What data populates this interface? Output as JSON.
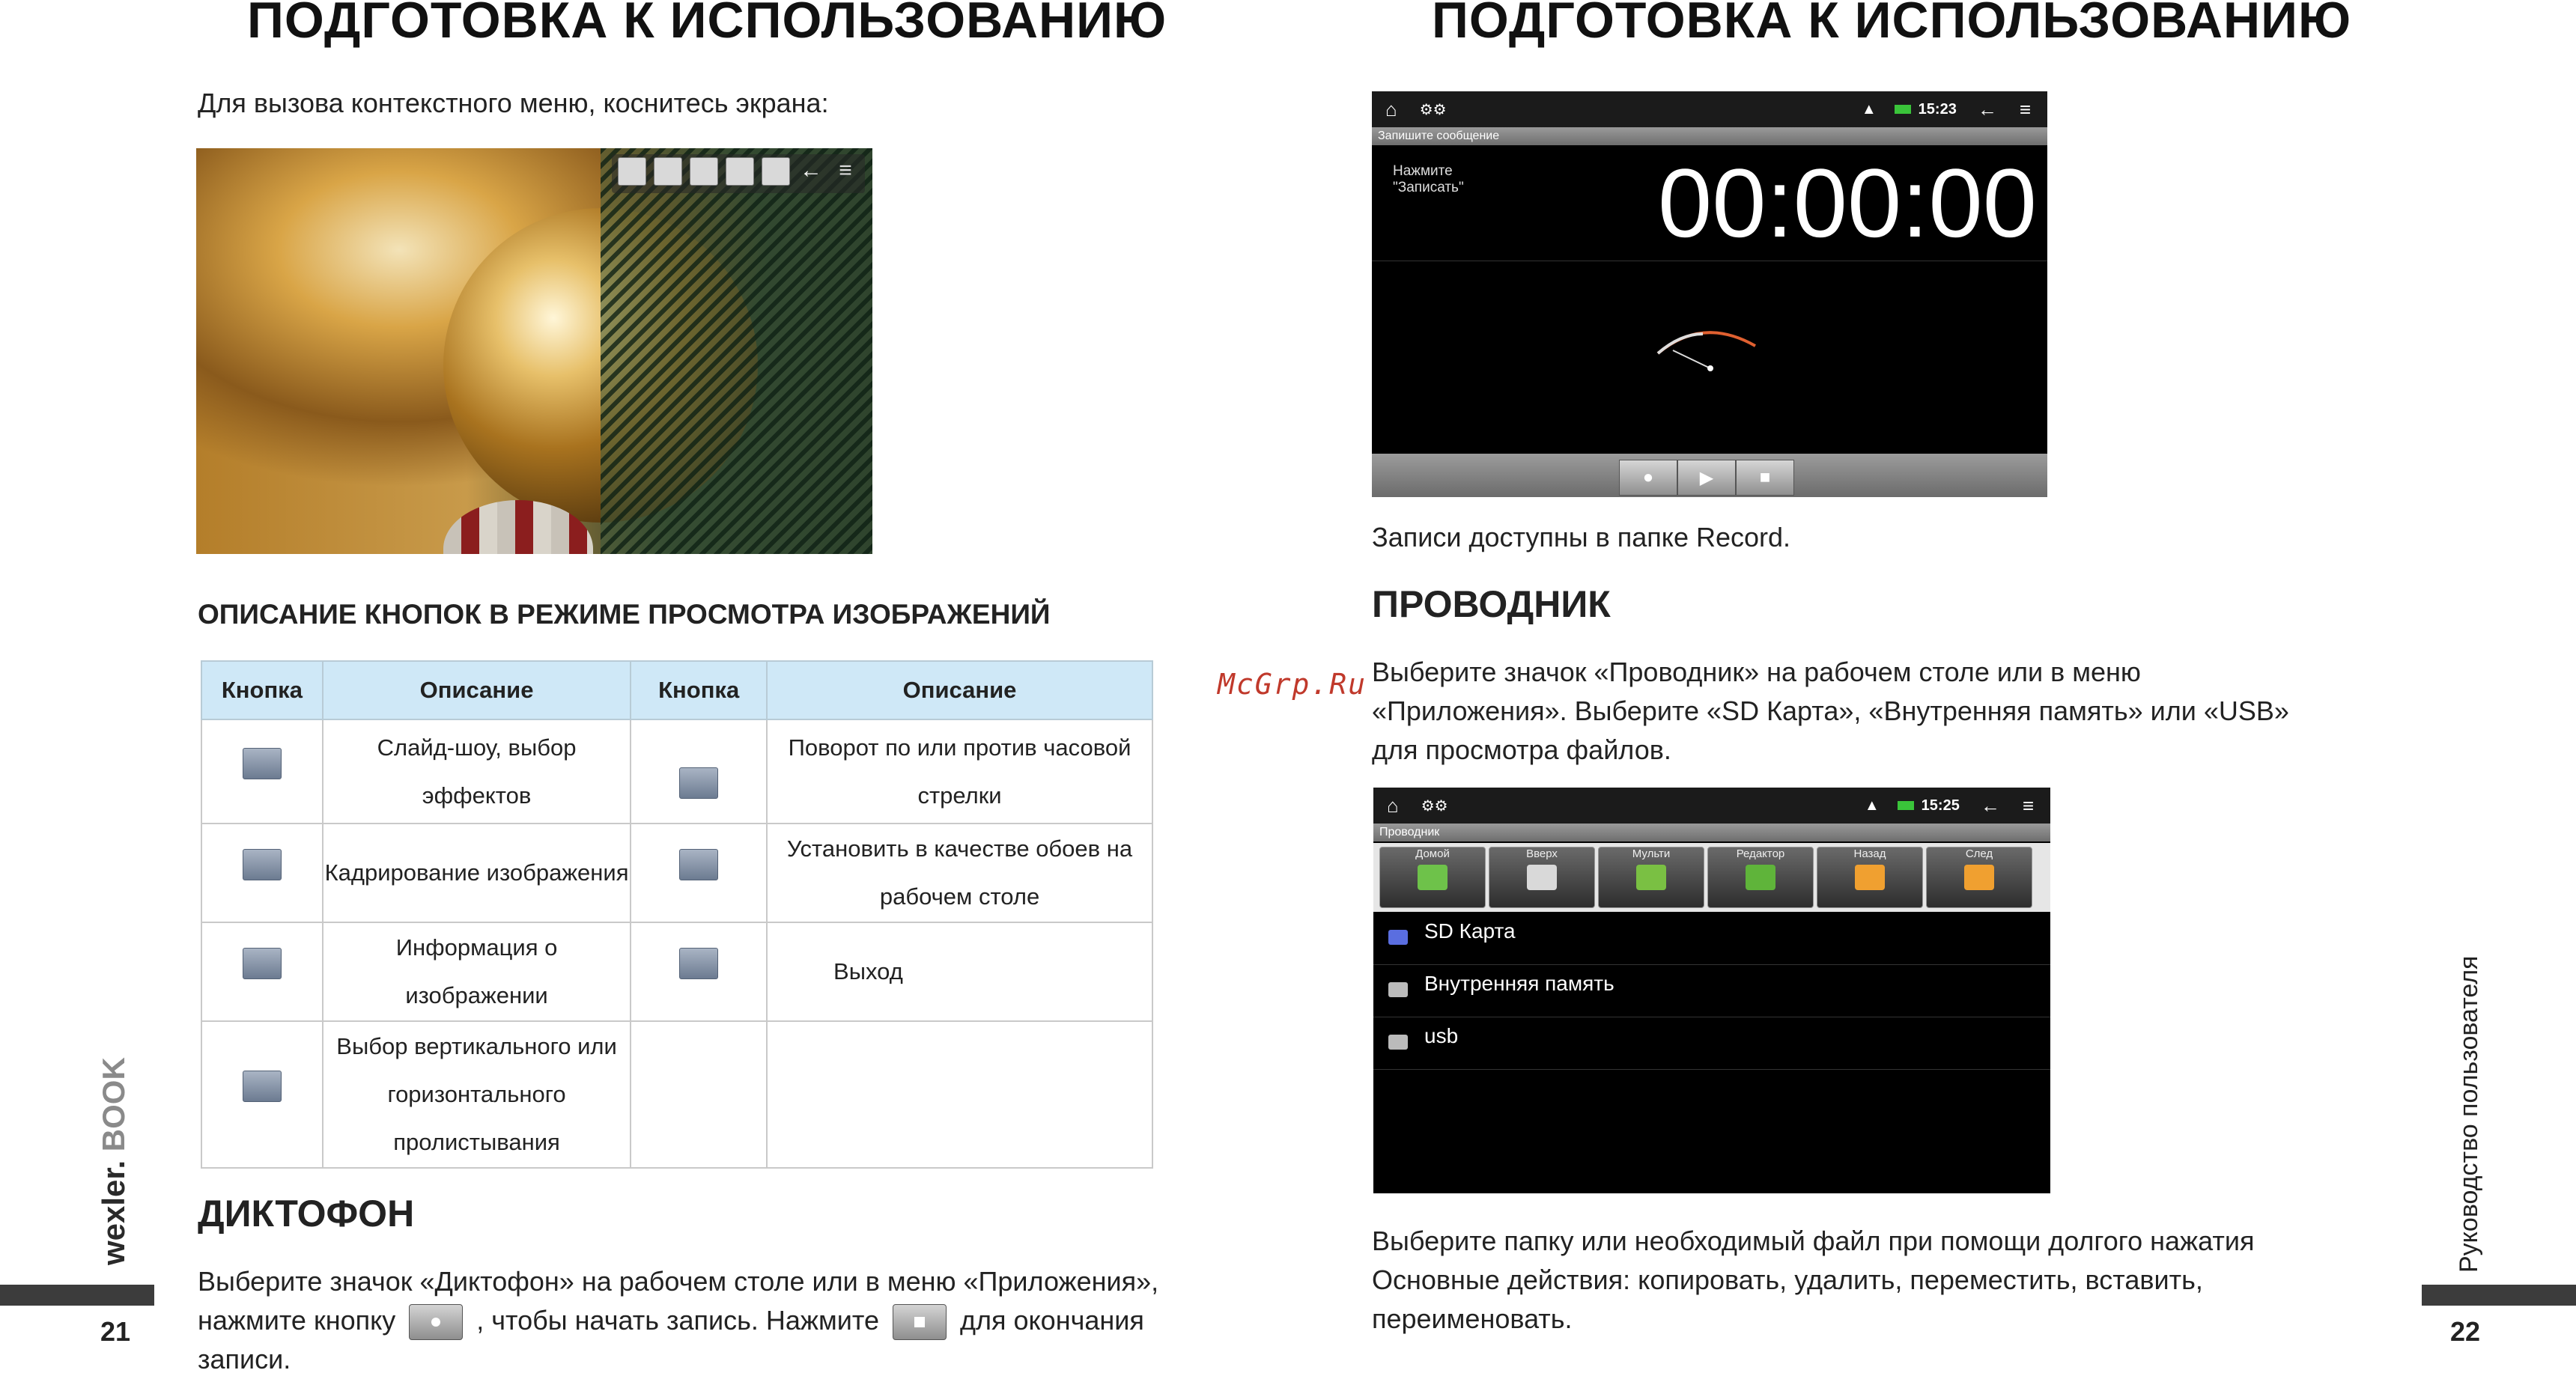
{
  "left_page": {
    "title": "ПОДГОТОВКА К ИСПОЛЬЗОВАНИЮ",
    "intro": "Для вызова контекстного меню, коснитесь экрана:",
    "table_heading": "ОПИСАНИЕ КНОПОК В РЕЖИМЕ ПРОСМОТРА ИЗОБРАЖЕНИЙ",
    "table": {
      "headers": [
        "Кнопка",
        "Описание",
        "Кнопка",
        "Описание"
      ],
      "rows": [
        {
          "desc1": "Слайд-шоу, выбор эффектов",
          "desc2": "Поворот по или против часовой стрелки"
        },
        {
          "desc1": "Кадрирование изображения",
          "desc2": "Установить в качестве обоев на рабочем столе"
        },
        {
          "desc1": "Информация о изображении",
          "desc2": "Выход"
        },
        {
          "desc1": "Выбор вертикального или горизонтального пролистывания",
          "desc2": ""
        }
      ]
    },
    "dictaphone_heading": "ДИКТОФОН",
    "dictaphone_text_1": "Выберите значок «Диктофон» на рабочем столе или в меню «Приложения»,",
    "dictaphone_text_2a": "нажмите кнопку",
    "dictaphone_text_2b": ", чтобы начать запись. Нажмите",
    "dictaphone_text_2c": "для окончания",
    "dictaphone_text_3": "записи.",
    "brand_text": "wexler.",
    "brand_suffix": "BOOK",
    "page_number": "21"
  },
  "right_page": {
    "title": "ПОДГОТОВКА К ИСПОЛЬЗОВАНИЮ",
    "recorder": {
      "time": "15:23",
      "subtitle": "Запишите сообщение",
      "hint": "Нажмите \"Записать\"",
      "timer": "00:00:00"
    },
    "record_note": "Записи доступны в папке Record.",
    "explorer_heading": "ПРОВОДНИК",
    "watermark": "McGrp.Ru",
    "explorer_text_1": "Выберите значок «Проводник» на рабочем столе или в меню",
    "explorer_text_2": "«Приложения». Выберите «SD Карта», «Внутренняя память» или «USB»",
    "explorer_text_3": "для просмотра файлов.",
    "file_manager": {
      "time": "15:25",
      "subtitle": "Проводник",
      "tools": [
        "Домой",
        "Вверх",
        "Мульти",
        "Редактор",
        "Назад",
        "След"
      ],
      "tool_colors": [
        "#6ec24a",
        "#d9d9d9",
        "#7ac043",
        "#5fb43a",
        "#f0a030",
        "#f0a030"
      ],
      "items": [
        "SD Карта",
        "Внутренняя память",
        "usb"
      ]
    },
    "bottom_text_1": "Выберите папку или необходимый файл при помощи долгого нажатия",
    "bottom_text_2": "Основные действия: копировать, удалить, переместить, вставить,",
    "bottom_text_3": "переименовать.",
    "side_text": "Руководство пользователя",
    "page_number": "22"
  }
}
